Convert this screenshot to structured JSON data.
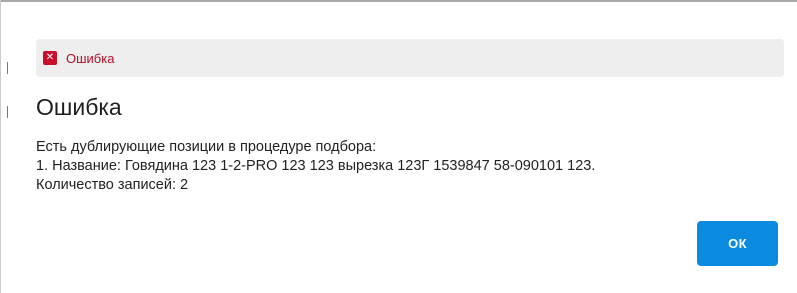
{
  "dialog": {
    "banner": {
      "icon": "close-icon",
      "icon_glyph": "✕",
      "text": "Ошибка",
      "color": "#c8102e"
    },
    "title": "Ошибка",
    "message": {
      "line1": "Есть дублирующие позиции в процедуре подбора:",
      "line2": "1. Название: Говядина 123 1-2-PRO 123 123 вырезка 123Г 1539847 58-090101 123.",
      "line3": "Количество записей: 2"
    },
    "ok_button": {
      "label": "ОК",
      "color": "#0a8be0"
    }
  }
}
